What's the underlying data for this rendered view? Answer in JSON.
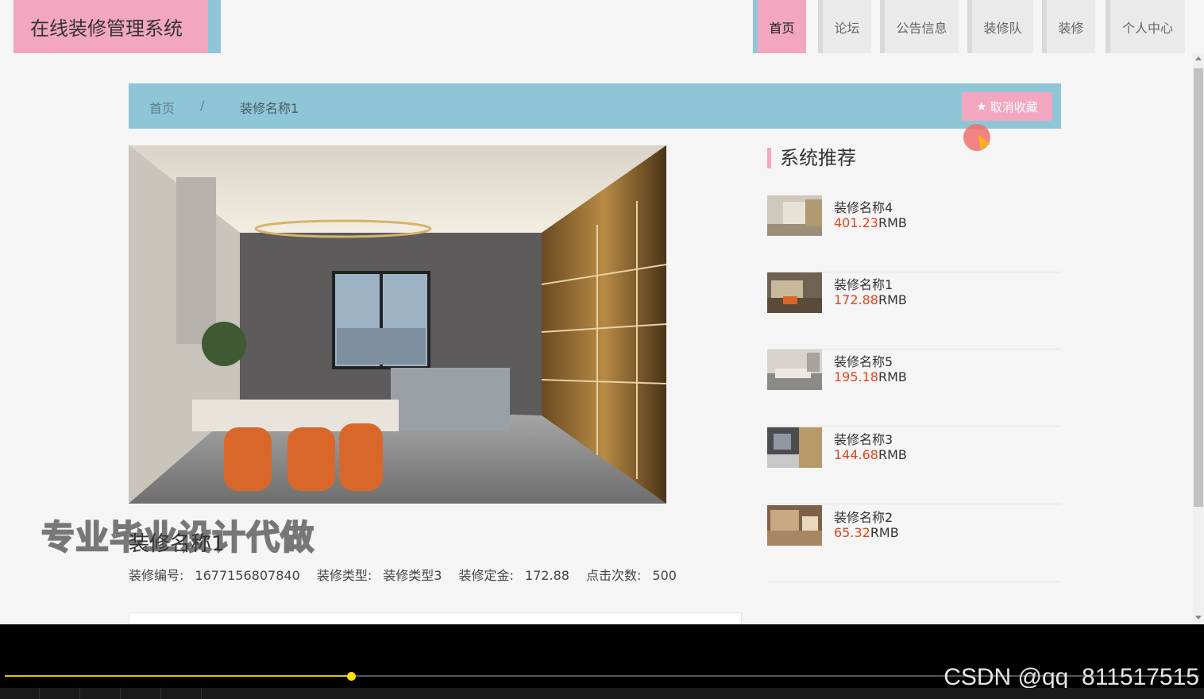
{
  "header": {
    "logo": "在线装修管理系统",
    "nav": [
      {
        "label": "首页",
        "active": true
      },
      {
        "label": "论坛",
        "active": false
      },
      {
        "label": "公告信息",
        "active": false
      },
      {
        "label": "装修队",
        "active": false
      },
      {
        "label": "装修",
        "active": false
      },
      {
        "label": "个人中心",
        "active": false
      }
    ]
  },
  "breadcrumb": {
    "home": "首页",
    "separator": "/",
    "current": "装修名称1",
    "favorite_button": "取消收藏",
    "favorite_icon": "star-icon"
  },
  "detail": {
    "title": "装修名称1",
    "fields": [
      {
        "label": "装修编号:",
        "value": "1677156807840"
      },
      {
        "label": "装修类型:",
        "value": "装修类型3"
      },
      {
        "label": "装修定金:",
        "value": "172.88"
      },
      {
        "label": "点击次数:",
        "value": "500"
      }
    ]
  },
  "overlay": {
    "watermark": "专业毕业设计代做",
    "credit": "CSDN @qq_811517515"
  },
  "sidebar": {
    "heading": "系统推荐",
    "items": [
      {
        "name": "装修名称4",
        "price": "401.23",
        "unit": "RMB"
      },
      {
        "name": "装修名称1",
        "price": "172.88",
        "unit": "RMB"
      },
      {
        "name": "装修名称5",
        "price": "195.18",
        "unit": "RMB"
      },
      {
        "name": "装修名称3",
        "price": "144.68",
        "unit": "RMB"
      },
      {
        "name": "装修名称2",
        "price": "65.32",
        "unit": "RMB"
      }
    ]
  },
  "player": {
    "progress": 0.29
  },
  "colors": {
    "pink": "#f2a6bf",
    "blue": "#8fc6d7",
    "price": "#e0451b"
  }
}
